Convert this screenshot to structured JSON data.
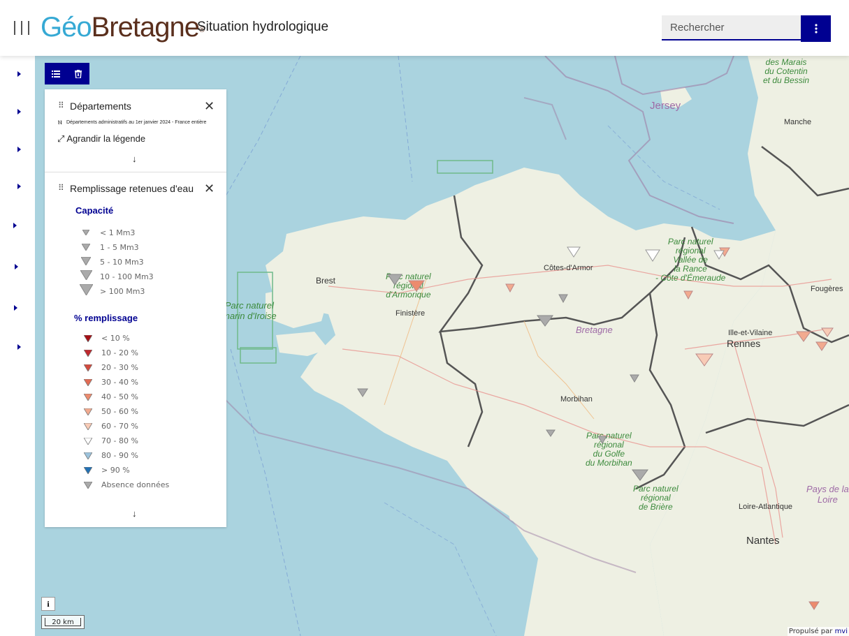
{
  "header": {
    "logo_part1": "Géo",
    "logo_part2": "Bretagne",
    "logo_reg": "®",
    "title": "Situation hydrologique",
    "search_placeholder": "Rechercher",
    "more_icon": "vertical-dots-icon"
  },
  "colors": {
    "accent": "#000091",
    "logo_blue": "#36a9d4",
    "logo_brown": "#5a2f1d",
    "sea": "#aad3df",
    "land": "#eef0e3"
  },
  "toolbar": {
    "list_icon": "list-icon",
    "delete_icon": "trash-icon"
  },
  "legend": {
    "departements": {
      "title": "Départements",
      "subtitle": "Départements administratifs au 1er janvier 2024 - France entière",
      "enlarge": "Agrandir la légende"
    },
    "retenues": {
      "title": "Remplissage retenues d'eau",
      "capacity_heading": "Capacité",
      "capacity": [
        {
          "label": "< 1 Mm3"
        },
        {
          "label": "1 - 5 Mm3"
        },
        {
          "label": "5 - 10 Mm3"
        },
        {
          "label": "10 - 100 Mm3"
        },
        {
          "label": "> 100 Mm3"
        }
      ],
      "fill_heading": "% remplissage",
      "fill": [
        {
          "label": "< 10 %",
          "color": "#a50f15"
        },
        {
          "label": "10 - 20 %",
          "color": "#c0282d"
        },
        {
          "label": "20 - 30 %",
          "color": "#d24a3e"
        },
        {
          "label": "30 - 40 %",
          "color": "#e26b54"
        },
        {
          "label": "40 - 50 %",
          "color": "#ec8b6e"
        },
        {
          "label": "50 - 60 %",
          "color": "#f2aa8f"
        },
        {
          "label": "60 - 70 %",
          "color": "#f8cbb6"
        },
        {
          "label": "70 - 80 %",
          "color": "#ffffff"
        },
        {
          "label": "80 - 90 %",
          "color": "#9cc3dc"
        },
        {
          "label": "> 90 %",
          "color": "#2171b5"
        },
        {
          "label": "Absence données",
          "color": "#aaaaaa"
        }
      ]
    }
  },
  "map": {
    "scale": "20 km",
    "attribution_prefix": "Propulsé par ",
    "attribution_link": "mvi",
    "info": "i",
    "places": {
      "jersey": "Jersey",
      "manche": "Manche",
      "marais1": "des Marais",
      "marais2": "du Cotentin",
      "marais3": "et du Bessin",
      "cotes": "Côtes-d'Armor",
      "brest": "Brest",
      "finistere": "Finistère",
      "bretagne": "Bretagne",
      "rennes": "Rennes",
      "ille": "Ille-et-Vilaine",
      "fougeres": "Fougères",
      "morbihan": "Morbihan",
      "loire": "Loire-Atlantique",
      "nantes": "Nantes",
      "pays1": "Pays de la",
      "pays2": "Loire"
    },
    "parks": {
      "armorique": "Parc naturel\nrégional\nd'Armorique",
      "iroise": "Parc naturel\nmarin d'Iroise",
      "rance": "Parc naturel\nrégional\nVallée de\nla Rance\n- Côte d'Émeraude",
      "golfe": "Parc naturel\nrégional\ndu Golfe\ndu Morbihan",
      "briere": "Parc naturel\nrégional\nde Brière"
    }
  }
}
